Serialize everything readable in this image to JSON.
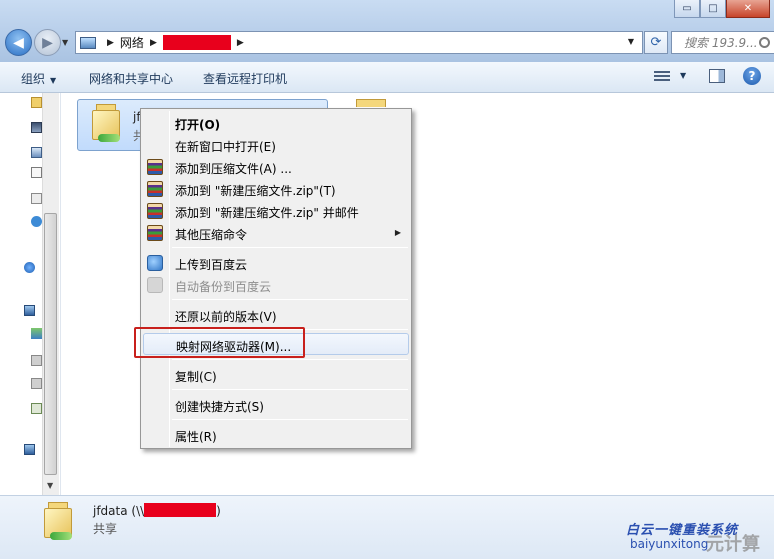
{
  "window": {
    "minimize_glyph": "▭",
    "maximize_glyph": "□",
    "close_glyph": "✕"
  },
  "address": {
    "segment_network": "网络",
    "separator": "▶",
    "dropdown_glyph": "▼",
    "redacted_color": "#e8001c"
  },
  "search": {
    "placeholder": "搜索 193.9..."
  },
  "toolbar": {
    "organize": "组织",
    "network_center": "网络和共享中心",
    "remote_printers": "查看远程打印机",
    "dropdown_glyph": "▼",
    "help_glyph": "?"
  },
  "content": {
    "selected_item_name": "jf",
    "selected_item_sub": "共"
  },
  "context_menu": {
    "items": [
      {
        "label": "打开(O)",
        "bold": true
      },
      {
        "label": "在新窗口中打开(E)"
      },
      {
        "label": "添加到压缩文件(A) ...",
        "icon": "winrar-icon"
      },
      {
        "label": "添加到 \"新建压缩文件.zip\"(T)",
        "icon": "winrar-icon"
      },
      {
        "label": "添加到 \"新建压缩文件.zip\" 并邮件",
        "icon": "winrar-icon"
      },
      {
        "label": "其他压缩命令",
        "icon": "winrar-icon",
        "submenu": true
      },
      {
        "label": "上传到百度云",
        "icon": "baidu-cloud-icon"
      },
      {
        "label": "自动备份到百度云",
        "icon": "baidu-cloud-icon",
        "disabled": true
      },
      {
        "label": "还原以前的版本(V)"
      },
      {
        "label": "映射网络驱动器(M)...",
        "highlighted": true
      },
      {
        "label": "复制(C)"
      },
      {
        "label": "创建快捷方式(S)"
      },
      {
        "label": "属性(R)"
      }
    ],
    "submenu_glyph": "▶"
  },
  "details": {
    "title_prefix": "jfdata (\\\\",
    "title_suffix": ")",
    "subtitle": "共享"
  },
  "watermark": {
    "line1": "白云一键重装系统",
    "line2": "baiyunxitong",
    "line3": "元计算"
  }
}
